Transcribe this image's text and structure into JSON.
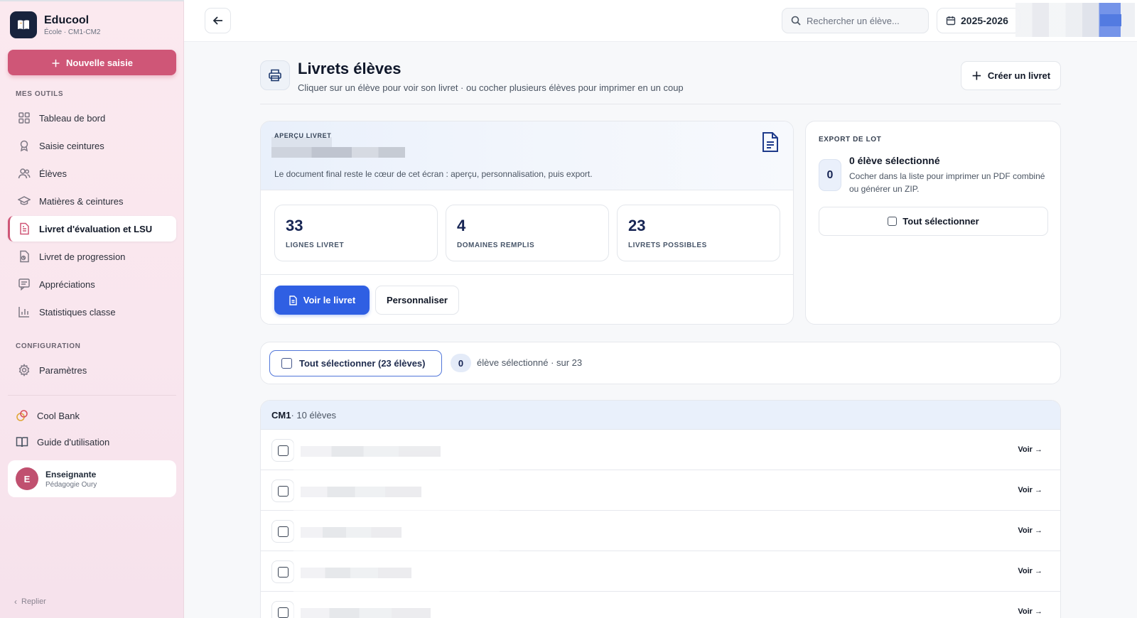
{
  "sidebar": {
    "brand_name": "Educool",
    "brand_sub": "École · CM1-CM2",
    "new_entry": "Nouvelle saisie",
    "section_tools": "MES OUTILS",
    "tools": [
      {
        "label": "Tableau de bord",
        "icon": "dashboard-icon"
      },
      {
        "label": "Saisie ceintures",
        "icon": "award-icon"
      },
      {
        "label": "Élèves",
        "icon": "users-icon"
      },
      {
        "label": "Matières & ceintures",
        "icon": "graduation-cap-icon"
      },
      {
        "label": "Livret d'évaluation et LSU",
        "icon": "document-icon",
        "active": true
      },
      {
        "label": "Livret de progression",
        "icon": "progress-doc-icon"
      },
      {
        "label": "Appréciations",
        "icon": "comment-icon"
      },
      {
        "label": "Statistiques classe",
        "icon": "bar-chart-icon"
      }
    ],
    "section_config": "CONFIGURATION",
    "settings": "Paramètres",
    "cool_bank": "Cool Bank",
    "guide": "Guide d'utilisation",
    "user_initial": "E",
    "user_name": "Enseignante",
    "user_role": "Pédagogie Oury",
    "collapse": "Replier",
    "accent": "#cf5677"
  },
  "topbar": {
    "search_placeholder": "Rechercher un élève...",
    "year": "2025-2026"
  },
  "header": {
    "title": "Livrets élèves",
    "subtitle": "Cliquer sur un élève pour voir son livret · ou cocher plusieurs élèves pour imprimer en un coup",
    "create_button": "Créer un livret"
  },
  "preview": {
    "label": "APERÇU LIVRET",
    "description": "Le document final reste le cœur de cet écran : aperçu, personnalisation, puis export.",
    "stats": [
      {
        "value": "33",
        "label": "LIGNES LIVRET"
      },
      {
        "value": "4",
        "label": "DOMAINES REMPLIS"
      },
      {
        "value": "23",
        "label": "LIVRETS POSSIBLES"
      }
    ],
    "view_button": "Voir le livret",
    "customize_button": "Personnaliser"
  },
  "export": {
    "label": "EXPORT DE LOT",
    "count": "0",
    "title": "0 élève sélectionné",
    "description": "Cocher dans la liste pour imprimer un PDF combiné ou générer un ZIP.",
    "select_all": "Tout sélectionner"
  },
  "selection": {
    "select_all": "Tout sélectionner (23 élèves)",
    "count": "0",
    "text": "élève sélectionné · sur 23"
  },
  "list": {
    "group": "CM1",
    "group_count": " · 10 élèves",
    "rows": [
      {
        "action": "Voir →"
      },
      {
        "action": "Voir →"
      },
      {
        "action": "Voir →"
      },
      {
        "action": "Voir →"
      },
      {
        "action": "Voir →"
      }
    ]
  },
  "colors": {
    "primary": "#2f5fe3",
    "brand_pink": "#cf5677",
    "navy": "#17233d"
  }
}
